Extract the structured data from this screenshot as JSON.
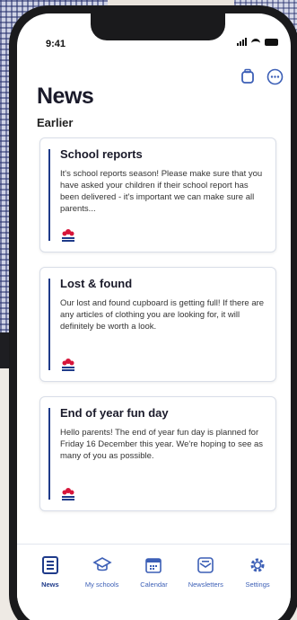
{
  "status_bar": {
    "time": "9:41"
  },
  "header": {
    "title": "News",
    "section": "Earlier"
  },
  "cards": [
    {
      "title": "School reports",
      "body": "It's school reports season! Please make sure that you have asked your children if their school report has been delivered - it's important we can make sure all parents..."
    },
    {
      "title": "Lost & found",
      "body": "Our lost and found cupboard is getting full! If there are any articles of clothing you are looking for, it will definitely be worth a look."
    },
    {
      "title": "End of year fun day",
      "body": "Hello parents! The end of year fun day is planned for Friday 16 December this year. We're hoping to see as many of you as possible."
    }
  ],
  "tabs": [
    {
      "label": "News",
      "icon": "news-icon",
      "active": true
    },
    {
      "label": "My schools",
      "icon": "graduation-cap-icon"
    },
    {
      "label": "Calendar",
      "icon": "calendar-icon"
    },
    {
      "label": "Newsletters",
      "icon": "newsletter-icon"
    },
    {
      "label": "Settings",
      "icon": "gear-icon"
    }
  ],
  "colors": {
    "primary": "#1f3b8a",
    "accent": "#3c5fb6",
    "nsw_red": "#d7153a"
  },
  "logo": {
    "text": "NSW"
  }
}
